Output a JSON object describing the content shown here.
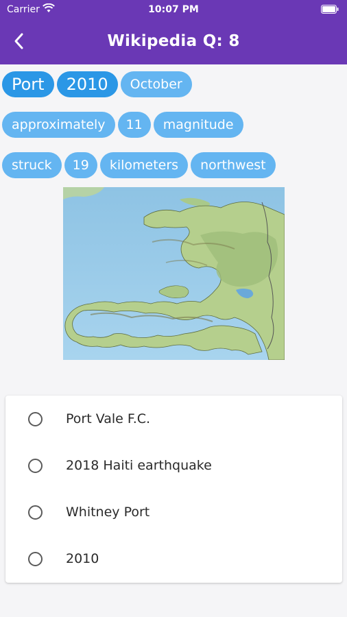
{
  "status": {
    "carrier": "Carrier",
    "time": "10:07 PM"
  },
  "nav": {
    "title": "Wikipedia Q: 8",
    "back_icon": "chevron-left-icon"
  },
  "chips": [
    [
      "Port",
      "2010",
      "October"
    ],
    [
      "approximately",
      "11",
      "magnitude"
    ],
    [
      "struck",
      "19",
      "kilometers",
      "northwest"
    ]
  ],
  "image": {
    "subject": "map"
  },
  "options": [
    {
      "label": "Port Vale F.C.",
      "selected": false
    },
    {
      "label": "2018 Haiti earthquake",
      "selected": false
    },
    {
      "label": "Whitney Port",
      "selected": false
    },
    {
      "label": "2010",
      "selected": false
    }
  ],
  "colors": {
    "header": "#6a38b5",
    "chip": "#64b5f1",
    "chip_highlight": "#2b97e6",
    "background": "#f5f5f7"
  }
}
